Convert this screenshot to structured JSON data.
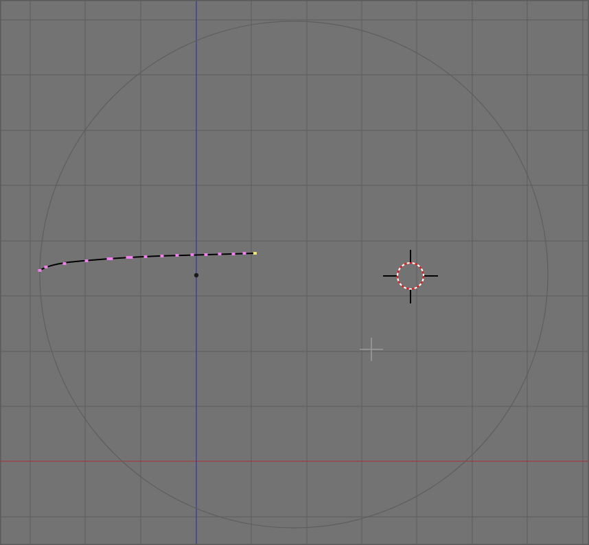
{
  "viewport": {
    "background": "#737373",
    "grid_color": "#606060",
    "border_color": "#5a5a5a",
    "x_axis_color": "#a04242",
    "y_axis_color": "#3b3ba6",
    "boundary_circle_color": "#5e5e5e"
  },
  "curve": {
    "stroke_color": "#000000",
    "control_point_color": "#ee80ee",
    "endpoint_color": "#f2e66a"
  },
  "object_origin": {
    "icon": "object-origin-dot",
    "color": "#1a1a1a"
  },
  "cursor_3d": {
    "icon": "3d-cursor-icon",
    "ring_color_a": "#e02020",
    "ring_color_b": "#ffffff",
    "crosshair_color": "#000000"
  },
  "view_center": {
    "icon": "view-center-crosshair-icon",
    "color": "#9a9a9a"
  }
}
